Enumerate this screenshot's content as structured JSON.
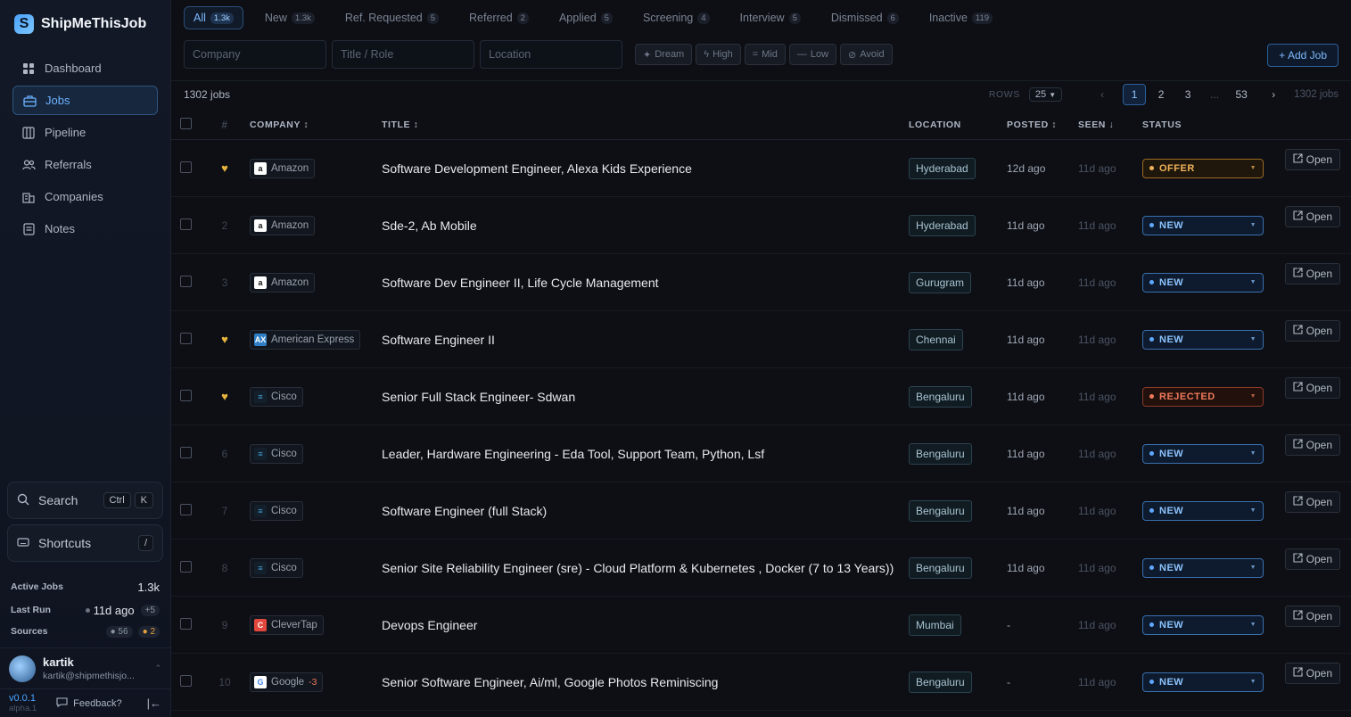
{
  "brand": {
    "logo": "S",
    "name": "ShipMeThisJob"
  },
  "nav": [
    {
      "label": "Dashboard",
      "icon": "grid-icon",
      "active": false
    },
    {
      "label": "Jobs",
      "icon": "briefcase-icon",
      "active": true
    },
    {
      "label": "Pipeline",
      "icon": "columns-icon",
      "active": false
    },
    {
      "label": "Referrals",
      "icon": "users-icon",
      "active": false
    },
    {
      "label": "Companies",
      "icon": "building-icon",
      "active": false
    },
    {
      "label": "Notes",
      "icon": "notes-icon",
      "active": false
    }
  ],
  "search": {
    "label": "Search",
    "key1": "Ctrl",
    "key2": "K"
  },
  "shortcuts": {
    "label": "Shortcuts",
    "key": "/"
  },
  "stats": {
    "active_jobs_label": "Active Jobs",
    "active_jobs_value": "1.3k",
    "last_run_label": "Last Run",
    "last_run_value": "11d ago",
    "last_run_extra": "+5",
    "sources_label": "Sources",
    "sources_ok": "56",
    "sources_warn": "2"
  },
  "user": {
    "name": "kartik",
    "email": "kartik@shipmethisjo..."
  },
  "footer": {
    "version": "v0.0.1",
    "channel": "alpha.1",
    "feedback": "Feedback?"
  },
  "tabs": [
    {
      "label": "All",
      "count": "1.3k",
      "active": true
    },
    {
      "label": "New",
      "count": "1.3k"
    },
    {
      "label": "Ref. Requested",
      "count": "5"
    },
    {
      "label": "Referred",
      "count": "2"
    },
    {
      "label": "Applied",
      "count": "5"
    },
    {
      "label": "Screening",
      "count": "4"
    },
    {
      "label": "Interview",
      "count": "5"
    },
    {
      "label": "Dismissed",
      "count": "6"
    },
    {
      "label": "Inactive",
      "count": "119"
    }
  ],
  "filters": {
    "company_placeholder": "Company",
    "title_placeholder": "Title / Role",
    "location_placeholder": "Location"
  },
  "priority_chips": [
    {
      "label": "Dream",
      "icon": "✦"
    },
    {
      "label": "High",
      "icon": "ϟ"
    },
    {
      "label": "Mid",
      "icon": "="
    },
    {
      "label": "Low",
      "icon": "—"
    },
    {
      "label": "Avoid",
      "icon": "⊘"
    }
  ],
  "add_job": "+ Add Job",
  "table_bar": {
    "count": "1302 jobs",
    "rows_label": "ROWS",
    "rows_value": "25",
    "pages": [
      "1",
      "2",
      "3",
      "...",
      "53"
    ],
    "total": "1302 jobs"
  },
  "columns": {
    "num": "#",
    "company": "COMPANY ↕",
    "title": "TITLE ↕",
    "location": "LOCATION",
    "posted": "POSTED ↕",
    "seen": "SEEN ↓",
    "status": "STATUS"
  },
  "open_label": "Open",
  "jobs": [
    {
      "num": "",
      "fav": true,
      "company": "Amazon",
      "logo": "a",
      "logo_bg": "#ffffff",
      "logo_fg": "#111111",
      "title": "Software Development Engineer, Alexa Kids Experience",
      "location": "Hyderabad",
      "posted": "12d ago",
      "seen": "11d ago",
      "status": "OFFER",
      "status_kind": "offer"
    },
    {
      "num": "2",
      "fav": false,
      "company": "Amazon",
      "logo": "a",
      "logo_bg": "#ffffff",
      "logo_fg": "#111111",
      "title": "Sde-2, Ab Mobile",
      "location": "Hyderabad",
      "posted": "11d ago",
      "seen": "11d ago",
      "status": "NEW",
      "status_kind": "new"
    },
    {
      "num": "3",
      "fav": false,
      "company": "Amazon",
      "logo": "a",
      "logo_bg": "#ffffff",
      "logo_fg": "#111111",
      "title": "Software Dev Engineer II, Life Cycle Management",
      "location": "Gurugram",
      "posted": "11d ago",
      "seen": "11d ago",
      "status": "NEW",
      "status_kind": "new"
    },
    {
      "num": "",
      "fav": true,
      "company": "American Express",
      "logo": "AX",
      "logo_bg": "#2f7fc6",
      "logo_fg": "#ffffff",
      "title": "Software Engineer II",
      "location": "Chennai",
      "posted": "11d ago",
      "seen": "11d ago",
      "status": "NEW",
      "status_kind": "new"
    },
    {
      "num": "",
      "fav": true,
      "company": "Cisco",
      "logo": "≡",
      "logo_bg": "#13202c",
      "logo_fg": "#4aa3d8",
      "title": "Senior Full Stack Engineer- Sdwan",
      "location": "Bengaluru",
      "posted": "11d ago",
      "seen": "11d ago",
      "status": "REJECTED",
      "status_kind": "rejected"
    },
    {
      "num": "6",
      "fav": false,
      "company": "Cisco",
      "logo": "≡",
      "logo_bg": "#13202c",
      "logo_fg": "#4aa3d8",
      "title": "Leader, Hardware Engineering - Eda Tool, Support Team, Python, Lsf",
      "location": "Bengaluru",
      "posted": "11d ago",
      "seen": "11d ago",
      "status": "NEW",
      "status_kind": "new"
    },
    {
      "num": "7",
      "fav": false,
      "company": "Cisco",
      "logo": "≡",
      "logo_bg": "#13202c",
      "logo_fg": "#4aa3d8",
      "title": "Software Engineer (full Stack)",
      "location": "Bengaluru",
      "posted": "11d ago",
      "seen": "11d ago",
      "status": "NEW",
      "status_kind": "new"
    },
    {
      "num": "8",
      "fav": false,
      "company": "Cisco",
      "logo": "≡",
      "logo_bg": "#13202c",
      "logo_fg": "#4aa3d8",
      "title": "Senior Site Reliability Engineer (sre) - Cloud Platform & Kubernetes , Docker (7 to 13 Years))",
      "location": "Bengaluru",
      "posted": "11d ago",
      "seen": "11d ago",
      "status": "NEW",
      "status_kind": "new"
    },
    {
      "num": "9",
      "fav": false,
      "company": "CleverTap",
      "logo": "C",
      "logo_bg": "#e2463c",
      "logo_fg": "#ffffff",
      "title": "Devops Engineer",
      "location": "Mumbai",
      "posted": "-",
      "seen": "11d ago",
      "status": "NEW",
      "status_kind": "new"
    },
    {
      "num": "10",
      "fav": false,
      "company": "Google",
      "badge": "-3",
      "logo": "G",
      "logo_bg": "#ffffff",
      "logo_fg": "#4285f4",
      "title": "Senior Software Engineer, Ai/ml, Google Photos Reminiscing",
      "location": "Bengaluru",
      "posted": "-",
      "seen": "11d ago",
      "status": "NEW",
      "status_kind": "new"
    }
  ]
}
